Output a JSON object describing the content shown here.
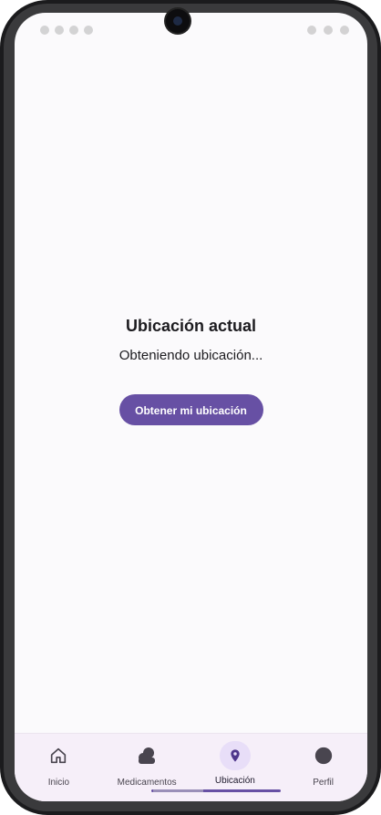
{
  "screen": {
    "title": "Ubicación actual",
    "status": "Obteniendo ubicación...",
    "action_button": "Obtener mi ubicación"
  },
  "bottom_nav": {
    "items": [
      {
        "label": "Inicio",
        "icon": "home-icon",
        "active": false
      },
      {
        "label": "Medicamentos",
        "icon": "medicine-icon",
        "active": false
      },
      {
        "label": "Ubicación",
        "icon": "location-icon",
        "active": true
      },
      {
        "label": "Perfil",
        "icon": "profile-icon",
        "active": false
      }
    ]
  },
  "colors": {
    "primary": "#6750a4",
    "background": "#fbfafc",
    "nav_background": "#f6eff9",
    "active_indicator": "#e8def8",
    "text": "#1c1b1f"
  }
}
